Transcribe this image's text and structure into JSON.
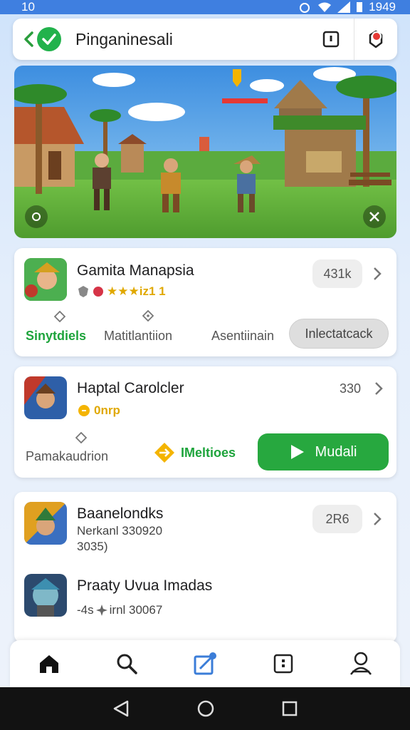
{
  "status_bar": {
    "time_left": "10",
    "time_right": "1949"
  },
  "header": {
    "title": "Pinganinesali"
  },
  "cards": [
    {
      "name": "Gamita Manapsia",
      "rating_text": "★★★iz1 1",
      "count": "431k",
      "tabs": [
        "Sinytdiels",
        "Matitlantiion",
        "Asentiinain",
        "Inlectatcack"
      ]
    },
    {
      "name": "Haptal Carolcler",
      "coins": "0nrp",
      "count": "330",
      "left_label": "Pamakaudrion",
      "mid_label": "IMeltioes",
      "play_label": "Mudali"
    }
  ],
  "list": [
    {
      "name": "Baanelondks",
      "sub1": "Nerkanl 330920",
      "sub2": "3035)",
      "count": "2R6"
    },
    {
      "name": "Praaty Uvua Imadas",
      "sub1": "-4s",
      "sub1b": "irnl 30067"
    }
  ],
  "icons": {
    "back": "chevron-left-icon",
    "check": "check-badge-icon",
    "menu": "square-menu-icon",
    "notif": "gear-notification-icon",
    "nav": [
      "home-icon",
      "search-icon",
      "edit-icon",
      "square-icon",
      "profile-icon"
    ],
    "sys": [
      "back-triangle-icon",
      "home-circle-icon",
      "recents-square-icon"
    ]
  },
  "colors": {
    "accent": "#27a83f",
    "status_bar": "#3f7fe0",
    "nav_active": "#3b7dd8"
  }
}
